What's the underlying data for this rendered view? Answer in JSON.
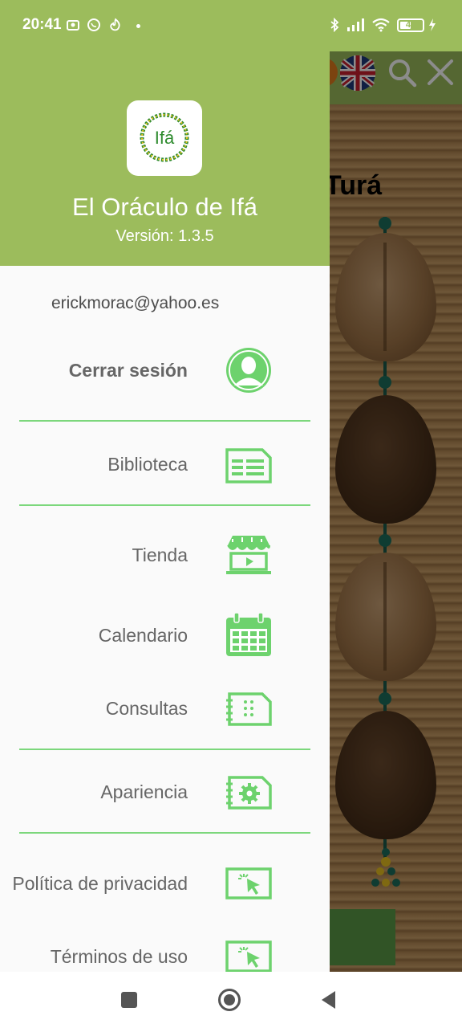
{
  "status_bar": {
    "time": "20:41",
    "battery": "48",
    "icons": [
      "teams-icon",
      "whatsapp-icon",
      "tinder-icon",
      "bluetooth-icon",
      "signal-icon",
      "wifi-icon",
      "charging-icon"
    ]
  },
  "background": {
    "title_fragment": "Turá"
  },
  "drawer": {
    "app_name": "El Oráculo de Ifá",
    "version": "Versión: 1.3.5",
    "logo_text": "Ifá",
    "email": "erickmorac@yahoo.es",
    "logout": "Cerrar sesión",
    "items": [
      {
        "label": "Biblioteca",
        "icon": "library-icon"
      },
      {
        "label": "Tienda",
        "icon": "store-icon"
      },
      {
        "label": "Calendario",
        "icon": "calendar-icon"
      },
      {
        "label": "Consultas",
        "icon": "consultations-icon"
      },
      {
        "label": "Apariencia",
        "icon": "appearance-settings-icon"
      },
      {
        "label": "Política de privacidad",
        "icon": "privacy-pointer-icon"
      },
      {
        "label": "Términos de uso",
        "icon": "terms-pointer-icon"
      }
    ]
  },
  "colors": {
    "header_green": "#9cbc5c",
    "icon_green": "#6dd26d",
    "divider_green": "#7cd77c"
  },
  "nav_bar": {
    "buttons": [
      "recents-button",
      "home-button",
      "back-button"
    ]
  }
}
